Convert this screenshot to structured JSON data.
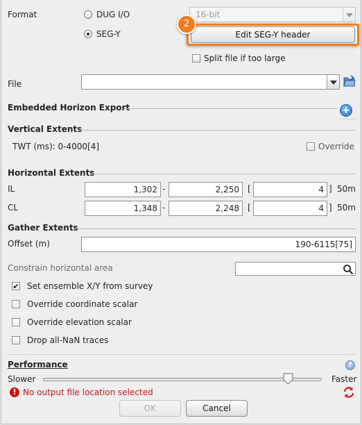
{
  "format": {
    "label": "Format",
    "option_dug": "DUG I/O",
    "option_segy": "SEG-Y",
    "bit_depth_value": "16-bit",
    "callout_number": "2",
    "edit_header_button": "Edit SEG-Y header",
    "split_label": "Split file if too large"
  },
  "file": {
    "label": "File",
    "value": ""
  },
  "embedded_horizon": {
    "title": "Embedded Horizon Export"
  },
  "vertical": {
    "title": "Vertical Extents",
    "twt_text": "TWT (ms): 0-4000[4]",
    "override_label": "Override"
  },
  "horizontal": {
    "title": "Horizontal Extents",
    "rows": [
      {
        "label": "IL",
        "from": "1,302",
        "dash": "-",
        "to": "2,250",
        "bracket": "[",
        "step": "4",
        "close": "]",
        "spacing": "50m"
      },
      {
        "label": "CL",
        "from": "1,348",
        "dash": "-",
        "to": "2,248",
        "bracket": "[",
        "step": "4",
        "close": "]",
        "spacing": "50m"
      }
    ]
  },
  "gather": {
    "title": "Gather Extents",
    "offset_label": "Offset (m)",
    "offset_value": "190-6115[75]"
  },
  "constrain": {
    "label": "Constrain horizontal area",
    "value": ""
  },
  "options": [
    {
      "label": "Set ensemble X/Y from survey",
      "checked": true,
      "mark": "✔"
    },
    {
      "label": "Override coordinate scalar",
      "checked": false,
      "mark": ""
    },
    {
      "label": "Override elevation scalar",
      "checked": false,
      "mark": ""
    },
    {
      "label": "Drop all-NaN traces",
      "checked": false,
      "mark": ""
    }
  ],
  "performance": {
    "title": "Performance",
    "slower": "Slower",
    "faster": "Faster",
    "level": 0.88
  },
  "status": {
    "error_text": "No output file location selected",
    "error_color": "#cc1111"
  },
  "buttons": {
    "ok": "OK",
    "cancel": "Cancel"
  },
  "colors": {
    "accent_orange": "#f07d1e",
    "section_rule": "#a9b8c9",
    "info_blue": "#2f74c8"
  }
}
